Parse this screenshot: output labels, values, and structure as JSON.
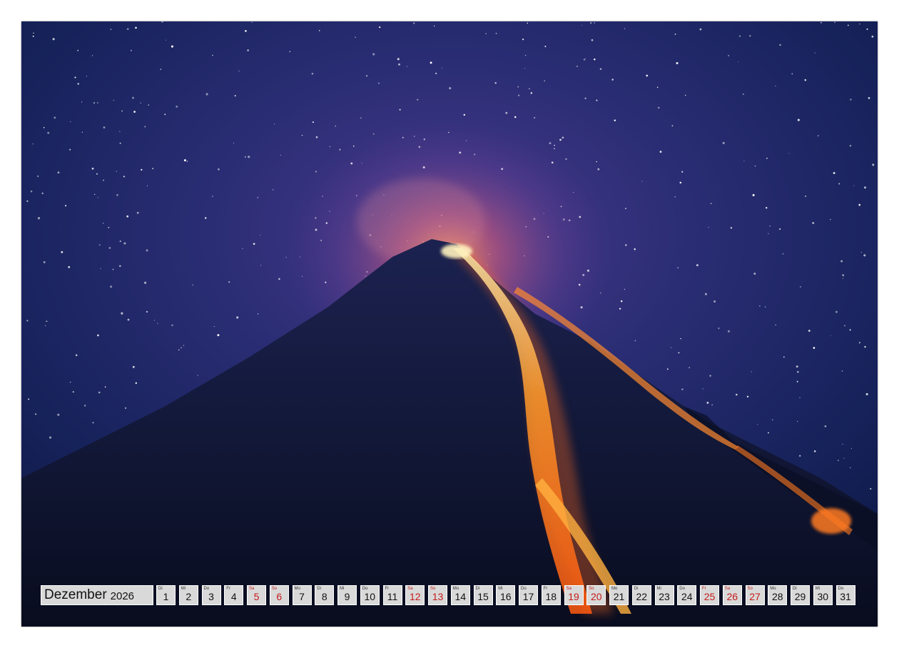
{
  "calendar": {
    "month": "Dezember",
    "year": "2026",
    "accent_color": "#c51a1a",
    "days": [
      {
        "n": "1",
        "w": "Di",
        "red": false
      },
      {
        "n": "2",
        "w": "Mi",
        "red": false
      },
      {
        "n": "3",
        "w": "Do",
        "red": false
      },
      {
        "n": "4",
        "w": "Fr",
        "red": false
      },
      {
        "n": "5",
        "w": "Sa",
        "red": true
      },
      {
        "n": "6",
        "w": "So",
        "red": true
      },
      {
        "n": "7",
        "w": "Mo",
        "red": false
      },
      {
        "n": "8",
        "w": "Di",
        "red": false
      },
      {
        "n": "9",
        "w": "Mi",
        "red": false
      },
      {
        "n": "10",
        "w": "Do",
        "red": false
      },
      {
        "n": "11",
        "w": "Fr",
        "red": false
      },
      {
        "n": "12",
        "w": "Sa",
        "red": true
      },
      {
        "n": "13",
        "w": "So",
        "red": true
      },
      {
        "n": "14",
        "w": "Mo",
        "red": false
      },
      {
        "n": "15",
        "w": "Di",
        "red": false
      },
      {
        "n": "16",
        "w": "Mi",
        "red": false
      },
      {
        "n": "17",
        "w": "Do",
        "red": false
      },
      {
        "n": "18",
        "w": "Fr",
        "red": false
      },
      {
        "n": "19",
        "w": "Sa",
        "red": true
      },
      {
        "n": "20",
        "w": "So",
        "red": true
      },
      {
        "n": "21",
        "w": "Mo",
        "red": false
      },
      {
        "n": "22",
        "w": "Di",
        "red": false
      },
      {
        "n": "23",
        "w": "Mi",
        "red": false
      },
      {
        "n": "24",
        "w": "Do",
        "red": false
      },
      {
        "n": "25",
        "w": "Fr",
        "red": true
      },
      {
        "n": "26",
        "w": "Sa",
        "red": true
      },
      {
        "n": "27",
        "w": "So",
        "red": true
      },
      {
        "n": "28",
        "w": "Mo",
        "red": false
      },
      {
        "n": "29",
        "w": "Di",
        "red": false
      },
      {
        "n": "30",
        "w": "Mi",
        "red": false
      },
      {
        "n": "31",
        "w": "Do",
        "red": false
      }
    ]
  }
}
